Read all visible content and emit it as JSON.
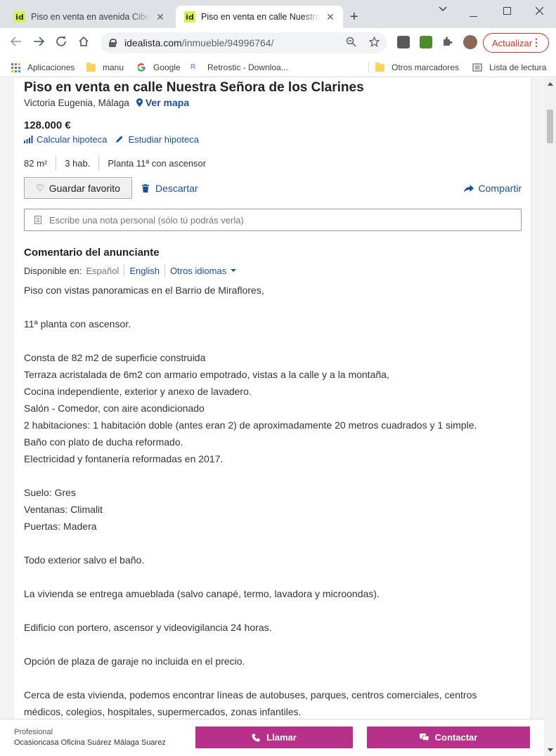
{
  "browser": {
    "tabs": [
      {
        "title": "Piso en venta en avenida Cibeles",
        "favicon": "id"
      },
      {
        "title": "Piso en venta en calle Nuestra Se",
        "favicon": "id"
      }
    ],
    "url_host": "idealista.com",
    "url_path": "/inmueble/94996764/",
    "update_label": "Actualizar",
    "bookmarks": [
      {
        "label": "Aplicaciones",
        "icon": "apps-grid-icon"
      },
      {
        "label": "manu",
        "icon": "folder-icon"
      },
      {
        "label": "Google",
        "icon": "google-icon"
      },
      {
        "label": "Retrostic - Downloa...",
        "icon": "retrostic-icon"
      },
      {
        "label": "Otros marcadores",
        "icon": "folder-icon"
      },
      {
        "label": "Lista de lectura",
        "icon": "reading-list-icon"
      }
    ]
  },
  "listing": {
    "title": "Piso en venta en calle Nuestra Señora de los Clarines",
    "location": "Victoria Eugenia, Málaga",
    "map_link": "Ver mapa",
    "price": "128.000 €",
    "calc_mortgage": "Calcular hipoteca",
    "study_mortgage": "Estudiar hipoteca",
    "features": [
      "82 m²",
      "3 hab.",
      "Planta 11ª con ascensor"
    ],
    "save_favorite": "Guardar favorito",
    "discard": "Descartar",
    "share": "Compartir",
    "note_placeholder": "Escribe una nota personal (sólo tú podrás verla)",
    "comment_heading": "Comentario del anunciante",
    "available_in": "Disponible en:",
    "languages": [
      "Español",
      "English",
      "Otros idiomas"
    ],
    "description": [
      "Piso con vistas panoramicas en el Barrio de Miraflores,",
      "",
      "11ª planta con ascensor.",
      "",
      "Consta de 82 m2 de superficie construida",
      "Terraza acristalada de 6m2 con armario empotrado, vistas a la calle y a la montaña,",
      "Cocina independiente, exterior y anexo de lavadero.",
      "Salón - Comedor, con aire acondicionado",
      "2 habitaciones: 1 habitación doble (antes eran 2) de aproximadamente 20 metros cuadrados y 1 simple.",
      "Baño con plato de ducha reformado.",
      "Electricidad y fontanería reformadas en 2017.",
      "",
      "Suelo: Gres",
      "Ventanas: Climalit",
      "Puertas: Madera",
      "",
      "Todo exterior salvo el baño.",
      "",
      "La vivienda se entrega amueblada (salvo canapé, termo, lavadora y microondas).",
      "",
      "Edificio con portero, ascensor y videovigilancia 24 horas.",
      "",
      "Opción de plaza de garaje no incluida en el precio.",
      "",
      "Cerca de esta vivienda, podemos encontrar líneas de autobuses, parques, centros comerciales, centros",
      "médicos, colegios, hospitales, supermercados, zonas infantiles."
    ]
  },
  "contact_bar": {
    "agent_type": "Profesional",
    "agent_name": "Ocasioncasa Oficina Suárez Málaga Suarez",
    "call_label": "Llamar",
    "contact_label": "Contactar"
  },
  "colors": {
    "link_blue": "#1a4fa0",
    "cta_magenta": "#b7308a",
    "idealista_green": "#d6f24c",
    "chrome_red": "#d93025"
  }
}
